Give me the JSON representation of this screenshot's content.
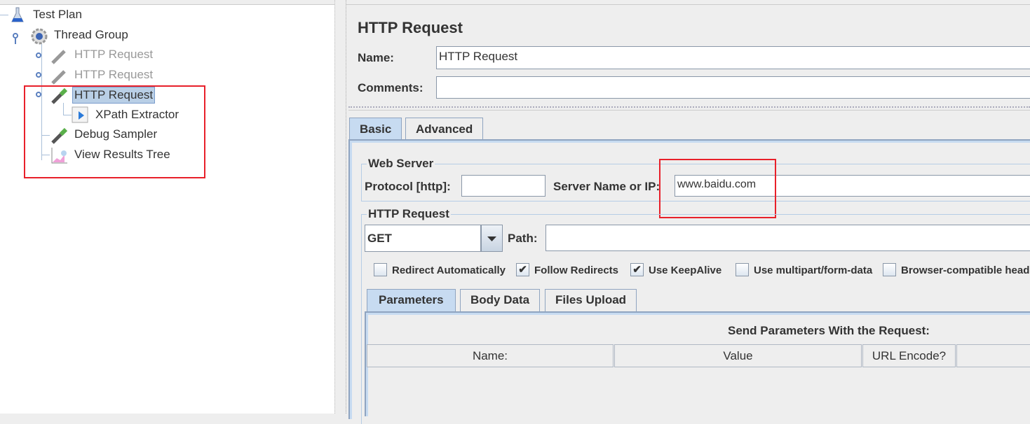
{
  "tree": {
    "items": [
      {
        "label": "Test Plan",
        "icon": "flask-icon",
        "state": "normal"
      },
      {
        "label": "Thread Group",
        "icon": "gear-icon",
        "state": "normal"
      },
      {
        "label": "HTTP Request",
        "icon": "pipette-icon",
        "state": "disabled"
      },
      {
        "label": "HTTP Request",
        "icon": "pipette-icon",
        "state": "disabled"
      },
      {
        "label": "HTTP Request",
        "icon": "pipette-icon",
        "state": "selected"
      },
      {
        "label": "XPath Extractor",
        "icon": "extractor-icon",
        "state": "normal"
      },
      {
        "label": "Debug Sampler",
        "icon": "pipette-icon",
        "state": "normal"
      },
      {
        "label": "View Results Tree",
        "icon": "chart-icon",
        "state": "normal"
      }
    ]
  },
  "panel": {
    "title": "HTTP Request",
    "name_label": "Name:",
    "name_value": "HTTP Request",
    "comments_label": "Comments:",
    "comments_value": "",
    "tabs": [
      "Basic",
      "Advanced"
    ],
    "web_server": {
      "legend": "Web Server",
      "protocol_label": "Protocol [http]:",
      "protocol_value": "",
      "server_label": "Server Name or IP:",
      "server_value": "www.baidu.com"
    },
    "http_request": {
      "legend": "HTTP Request",
      "method": "GET",
      "path_label": "Path:",
      "path_value": ""
    },
    "checkboxes": [
      {
        "label": "Redirect Automatically",
        "checked": false
      },
      {
        "label": "Follow Redirects",
        "checked": true
      },
      {
        "label": "Use KeepAlive",
        "checked": true
      },
      {
        "label": "Use multipart/form-data",
        "checked": false
      },
      {
        "label": "Browser-compatible headers",
        "checked": false
      }
    ],
    "sub_tabs": [
      "Parameters",
      "Body Data",
      "Files Upload"
    ],
    "params_title": "Send Parameters With the Request:",
    "columns": [
      "Name:",
      "Value",
      "URL Encode?",
      ""
    ]
  },
  "colors": {
    "highlight": "#e8202a",
    "selection": "#b9cfe6",
    "tab_active": "#c7dbf1"
  }
}
